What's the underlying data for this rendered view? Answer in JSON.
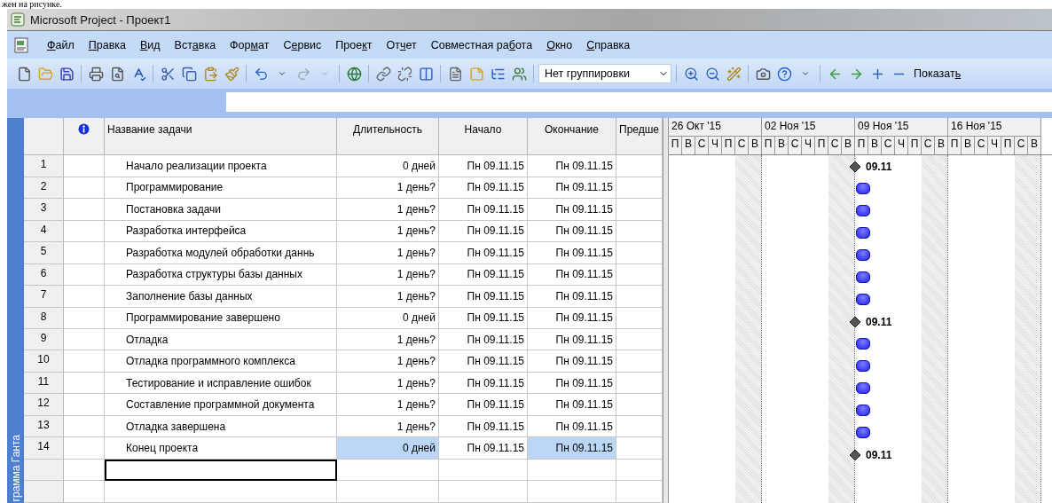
{
  "document_line": "жен на рисунке.",
  "window": {
    "title": "Microsoft Project - Проект1"
  },
  "menu": [
    {
      "accel": "Ф",
      "after": "айл"
    },
    {
      "accel": "П",
      "after": "равка"
    },
    {
      "accel": "В",
      "after": "ид"
    },
    {
      "before": "Вст",
      "accel": "а",
      "after": "вка"
    },
    {
      "before": "Фор",
      "accel": "м",
      "after": "ат"
    },
    {
      "before": "С",
      "accel": "е",
      "after": "рвис"
    },
    {
      "before": "Прое",
      "accel": "к",
      "after": "т"
    },
    {
      "before": "От",
      "accel": "ч",
      "after": "ет"
    },
    {
      "before": "Совместная ра",
      "accel": "б",
      "after": "ота"
    },
    {
      "accel": "О",
      "after": "кно"
    },
    {
      "accel": "С",
      "after": "правка"
    }
  ],
  "toolbar": {
    "grouping": "Нет группировки",
    "show": {
      "before": "Показат",
      "accel": "ь"
    }
  },
  "view_bar": {
    "label": "грамма Ганта"
  },
  "table": {
    "columns": {
      "name": "Название задачи",
      "duration": "Длительность",
      "start": "Начало",
      "finish": "Окончание",
      "predecessors": "Предше"
    },
    "rows": [
      {
        "id": "1",
        "name": "Начало реализации проекта",
        "duration": "0 дней",
        "start": "Пн 09.11.15",
        "finish": "Пн 09.11.15",
        "duration_selected": false,
        "finish_selected": false,
        "bar": {
          "kind": "milestone",
          "label": "09.11"
        }
      },
      {
        "id": "2",
        "name": "Программирование",
        "duration": "1 день?",
        "start": "Пн 09.11.15",
        "finish": "Пн 09.11.15",
        "duration_selected": false,
        "finish_selected": false,
        "bar": {
          "kind": "task"
        }
      },
      {
        "id": "3",
        "name": "Постановка задачи",
        "duration": "1 день?",
        "start": "Пн 09.11.15",
        "finish": "Пн 09.11.15",
        "duration_selected": false,
        "finish_selected": false,
        "bar": {
          "kind": "task"
        }
      },
      {
        "id": "4",
        "name": "Разработка интерфейса",
        "duration": "1 день?",
        "start": "Пн 09.11.15",
        "finish": "Пн 09.11.15",
        "duration_selected": false,
        "finish_selected": false,
        "bar": {
          "kind": "task"
        }
      },
      {
        "id": "5",
        "name": "Разработка модулей обработки даннь",
        "duration": "1 день?",
        "start": "Пн 09.11.15",
        "finish": "Пн 09.11.15",
        "duration_selected": false,
        "finish_selected": false,
        "bar": {
          "kind": "task"
        }
      },
      {
        "id": "6",
        "name": "Разработка структуры базы данных",
        "duration": "1 день?",
        "start": "Пн 09.11.15",
        "finish": "Пн 09.11.15",
        "duration_selected": false,
        "finish_selected": false,
        "bar": {
          "kind": "task"
        }
      },
      {
        "id": "7",
        "name": "Заполнение базы данных",
        "duration": "1 день?",
        "start": "Пн 09.11.15",
        "finish": "Пн 09.11.15",
        "duration_selected": false,
        "finish_selected": false,
        "bar": {
          "kind": "task"
        }
      },
      {
        "id": "8",
        "name": "Программирование завершено",
        "duration": "0 дней",
        "start": "Пн 09.11.15",
        "finish": "Пн 09.11.15",
        "duration_selected": false,
        "finish_selected": false,
        "bar": {
          "kind": "milestone",
          "label": "09.11"
        }
      },
      {
        "id": "9",
        "name": "Отладка",
        "duration": "1 день?",
        "start": "Пн 09.11.15",
        "finish": "Пн 09.11.15",
        "duration_selected": false,
        "finish_selected": false,
        "bar": {
          "kind": "task"
        }
      },
      {
        "id": "10",
        "name": "Отладка программного комплекса",
        "duration": "1 день?",
        "start": "Пн 09.11.15",
        "finish": "Пн 09.11.15",
        "duration_selected": false,
        "finish_selected": false,
        "bar": {
          "kind": "task"
        }
      },
      {
        "id": "11",
        "name": "Тестирование и исправление ошибок",
        "duration": "1 день?",
        "start": "Пн 09.11.15",
        "finish": "Пн 09.11.15",
        "duration_selected": false,
        "finish_selected": false,
        "bar": {
          "kind": "task"
        }
      },
      {
        "id": "12",
        "name": "Составление программной документа",
        "duration": "1 день?",
        "start": "Пн 09.11.15",
        "finish": "Пн 09.11.15",
        "duration_selected": false,
        "finish_selected": false,
        "bar": {
          "kind": "task"
        }
      },
      {
        "id": "13",
        "name": "Отладка завершена",
        "duration": "1 день?",
        "start": "Пн 09.11.15",
        "finish": "Пн 09.11.15",
        "duration_selected": false,
        "finish_selected": false,
        "bar": {
          "kind": "task"
        }
      },
      {
        "id": "14",
        "name": "Конец проекта",
        "duration": "0 дней",
        "start": "Пн 09.11.15",
        "finish": "Пн 09.11.15",
        "duration_selected": true,
        "finish_selected": true,
        "bar": {
          "kind": "milestone",
          "label": "09.11"
        }
      }
    ],
    "empty_rows": [
      {
        "selected": true
      },
      {
        "selected": false
      }
    ]
  },
  "timescale": [
    {
      "week": "26 Окт '15",
      "days": [
        {
          "label": "П",
          "weekend": false
        },
        {
          "label": "В",
          "weekend": false
        },
        {
          "label": "С",
          "weekend": false
        },
        {
          "label": "Ч",
          "weekend": false
        },
        {
          "label": "П",
          "weekend": false
        },
        {
          "label": "С",
          "weekend": true
        },
        {
          "label": "В",
          "weekend": true
        }
      ]
    },
    {
      "week": "02 Ноя '15",
      "days": [
        {
          "label": "П",
          "weekend": false
        },
        {
          "label": "В",
          "weekend": false
        },
        {
          "label": "С",
          "weekend": false
        },
        {
          "label": "Ч",
          "weekend": false
        },
        {
          "label": "П",
          "weekend": false
        },
        {
          "label": "С",
          "weekend": true
        },
        {
          "label": "В",
          "weekend": true
        }
      ]
    },
    {
      "week": "09 Ноя '15",
      "days": [
        {
          "label": "П",
          "weekend": false
        },
        {
          "label": "В",
          "weekend": false
        },
        {
          "label": "С",
          "weekend": false
        },
        {
          "label": "Ч",
          "weekend": false
        },
        {
          "label": "П",
          "weekend": false
        },
        {
          "label": "С",
          "weekend": true
        },
        {
          "label": "В",
          "weekend": true
        }
      ]
    },
    {
      "week": "16 Ноя '15",
      "days": [
        {
          "label": "П",
          "weekend": false
        },
        {
          "label": "В",
          "weekend": false
        },
        {
          "label": "С",
          "weekend": false
        },
        {
          "label": "Ч",
          "weekend": false
        },
        {
          "label": "П",
          "weekend": false
        },
        {
          "label": "С",
          "weekend": true
        },
        {
          "label": "В",
          "weekend": true
        }
      ]
    }
  ]
}
